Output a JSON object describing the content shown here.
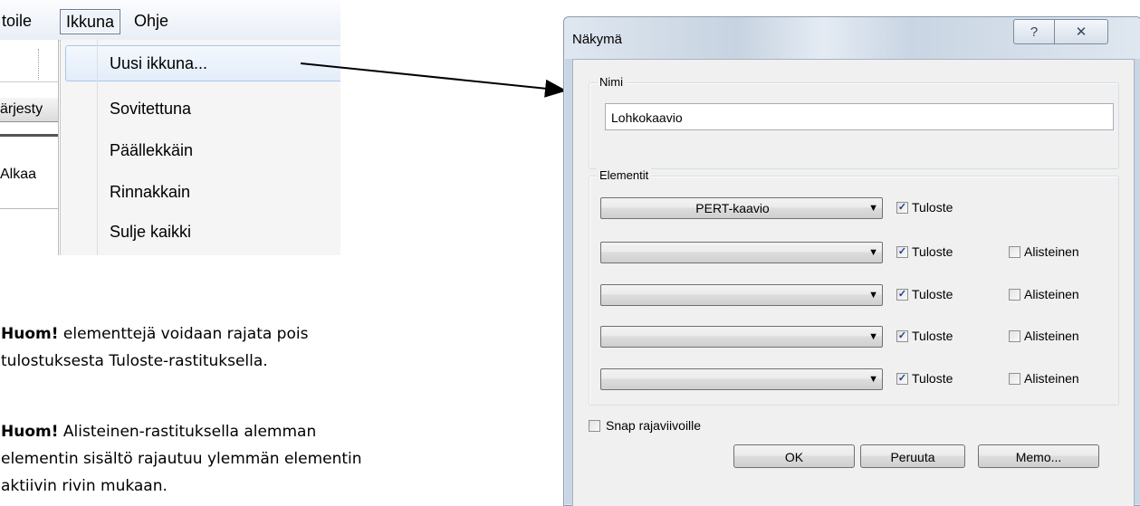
{
  "menubar": {
    "items": [
      "toile",
      "Ikkuna",
      "Ohje"
    ]
  },
  "left_strip": {
    "rows": [
      "ärjesty",
      "Alkaa"
    ]
  },
  "window_menu": {
    "items": [
      "Uusi ikkuna...",
      "Sovitettuna",
      "Päällekkäin",
      "Rinnakkain",
      "Sulje kaikki"
    ]
  },
  "notes": [
    {
      "bold": "Huom!",
      "text": " elementtejä voidaan rajata pois tulostuksesta Tuloste-rastituksella."
    },
    {
      "bold": "Huom!",
      "text": " Alisteinen-rastituksella alemman elementin sisältö rajautuu ylemmän elementin aktiivin rivin mukaan."
    }
  ],
  "dialog": {
    "title": "Näkymä",
    "help_glyph": "?",
    "close_glyph": "✕",
    "name_group": {
      "legend": "Nimi",
      "value": "Lohkokaavio"
    },
    "elements_group": {
      "legend": "Elementit",
      "rows": [
        {
          "combo": "PERT-kaavio",
          "tuloste_label": "Tuloste",
          "tuloste_checked": true,
          "alisteinen_label": "",
          "alisteinen_checked": false
        },
        {
          "combo": "",
          "tuloste_label": "Tuloste",
          "tuloste_checked": true,
          "alisteinen_label": "Alisteinen",
          "alisteinen_checked": false
        },
        {
          "combo": "",
          "tuloste_label": "Tuloste",
          "tuloste_checked": true,
          "alisteinen_label": "Alisteinen",
          "alisteinen_checked": false
        },
        {
          "combo": "",
          "tuloste_label": "Tuloste",
          "tuloste_checked": true,
          "alisteinen_label": "Alisteinen",
          "alisteinen_checked": false
        },
        {
          "combo": "",
          "tuloste_label": "Tuloste",
          "tuloste_checked": true,
          "alisteinen_label": "Alisteinen",
          "alisteinen_checked": false
        }
      ]
    },
    "snap": {
      "label": "Snap rajaviivoille",
      "checked": false
    },
    "buttons": {
      "ok": "OK",
      "cancel": "Peruuta",
      "memo": "Memo..."
    }
  }
}
